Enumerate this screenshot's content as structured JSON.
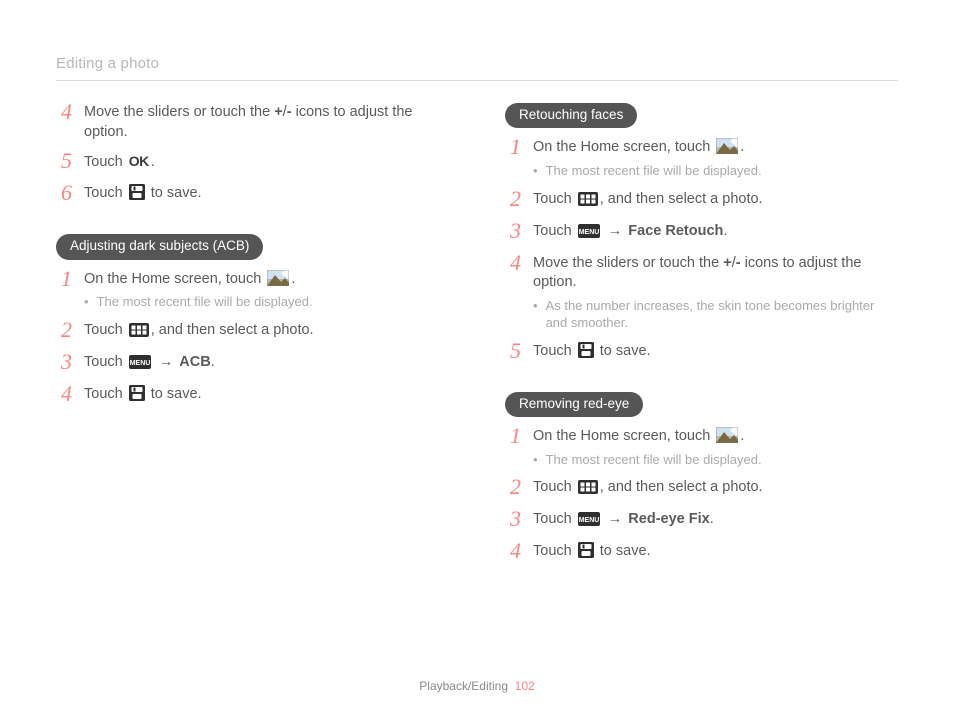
{
  "header": {
    "title": "Editing a photo"
  },
  "footer": {
    "section": "Playback/Editing",
    "page": "102"
  },
  "intro_steps": [
    {
      "n": "4",
      "parts": [
        "Move the sliders or touch the ",
        {
          "bold": "+"
        },
        "/",
        {
          "bold": "-"
        },
        " icons to adjust the option."
      ]
    },
    {
      "n": "5",
      "parts": [
        "Touch ",
        {
          "icon": "ok"
        },
        "."
      ]
    },
    {
      "n": "6",
      "parts": [
        "Touch ",
        {
          "icon": "save"
        },
        " to save."
      ]
    }
  ],
  "sections": [
    {
      "col": "left",
      "heading": "Adjusting dark subjects (ACB)",
      "steps": [
        {
          "n": "1",
          "parts": [
            "On the Home screen, touch ",
            {
              "icon": "photo"
            },
            "."
          ],
          "sub": [
            "The most recent file will be displayed."
          ]
        },
        {
          "n": "2",
          "parts": [
            "Touch ",
            {
              "icon": "thumbs"
            },
            ", and then select a photo."
          ]
        },
        {
          "n": "3",
          "parts": [
            "Touch ",
            {
              "icon": "menu"
            },
            " ",
            {
              "arrow": "→"
            },
            " ",
            {
              "bold": "ACB"
            },
            "."
          ]
        },
        {
          "n": "4",
          "parts": [
            "Touch ",
            {
              "icon": "save"
            },
            " to save."
          ]
        }
      ]
    },
    {
      "col": "right",
      "heading": "Retouching faces",
      "steps": [
        {
          "n": "1",
          "parts": [
            "On the Home screen, touch ",
            {
              "icon": "photo"
            },
            "."
          ],
          "sub": [
            "The most recent file will be displayed."
          ]
        },
        {
          "n": "2",
          "parts": [
            "Touch ",
            {
              "icon": "thumbs"
            },
            ", and then select a photo."
          ]
        },
        {
          "n": "3",
          "parts": [
            "Touch ",
            {
              "icon": "menu"
            },
            " ",
            {
              "arrow": "→"
            },
            " ",
            {
              "bold": "Face Retouch"
            },
            "."
          ]
        },
        {
          "n": "4",
          "parts": [
            "Move the sliders or touch the ",
            {
              "bold": "+"
            },
            "/",
            {
              "bold": "-"
            },
            " icons to adjust the option."
          ],
          "sub": [
            "As the number increases, the skin tone becomes brighter and smoother."
          ]
        },
        {
          "n": "5",
          "parts": [
            "Touch ",
            {
              "icon": "save"
            },
            " to save."
          ]
        }
      ]
    },
    {
      "col": "right",
      "heading": "Removing red-eye",
      "steps": [
        {
          "n": "1",
          "parts": [
            "On the Home screen, touch ",
            {
              "icon": "photo"
            },
            "."
          ],
          "sub": [
            "The most recent file will be displayed."
          ]
        },
        {
          "n": "2",
          "parts": [
            "Touch ",
            {
              "icon": "thumbs"
            },
            ", and then select a photo."
          ]
        },
        {
          "n": "3",
          "parts": [
            "Touch ",
            {
              "icon": "menu"
            },
            " ",
            {
              "arrow": "→"
            },
            " ",
            {
              "bold": "Red-eye Fix"
            },
            "."
          ]
        },
        {
          "n": "4",
          "parts": [
            "Touch ",
            {
              "icon": "save"
            },
            " to save."
          ]
        }
      ]
    }
  ]
}
